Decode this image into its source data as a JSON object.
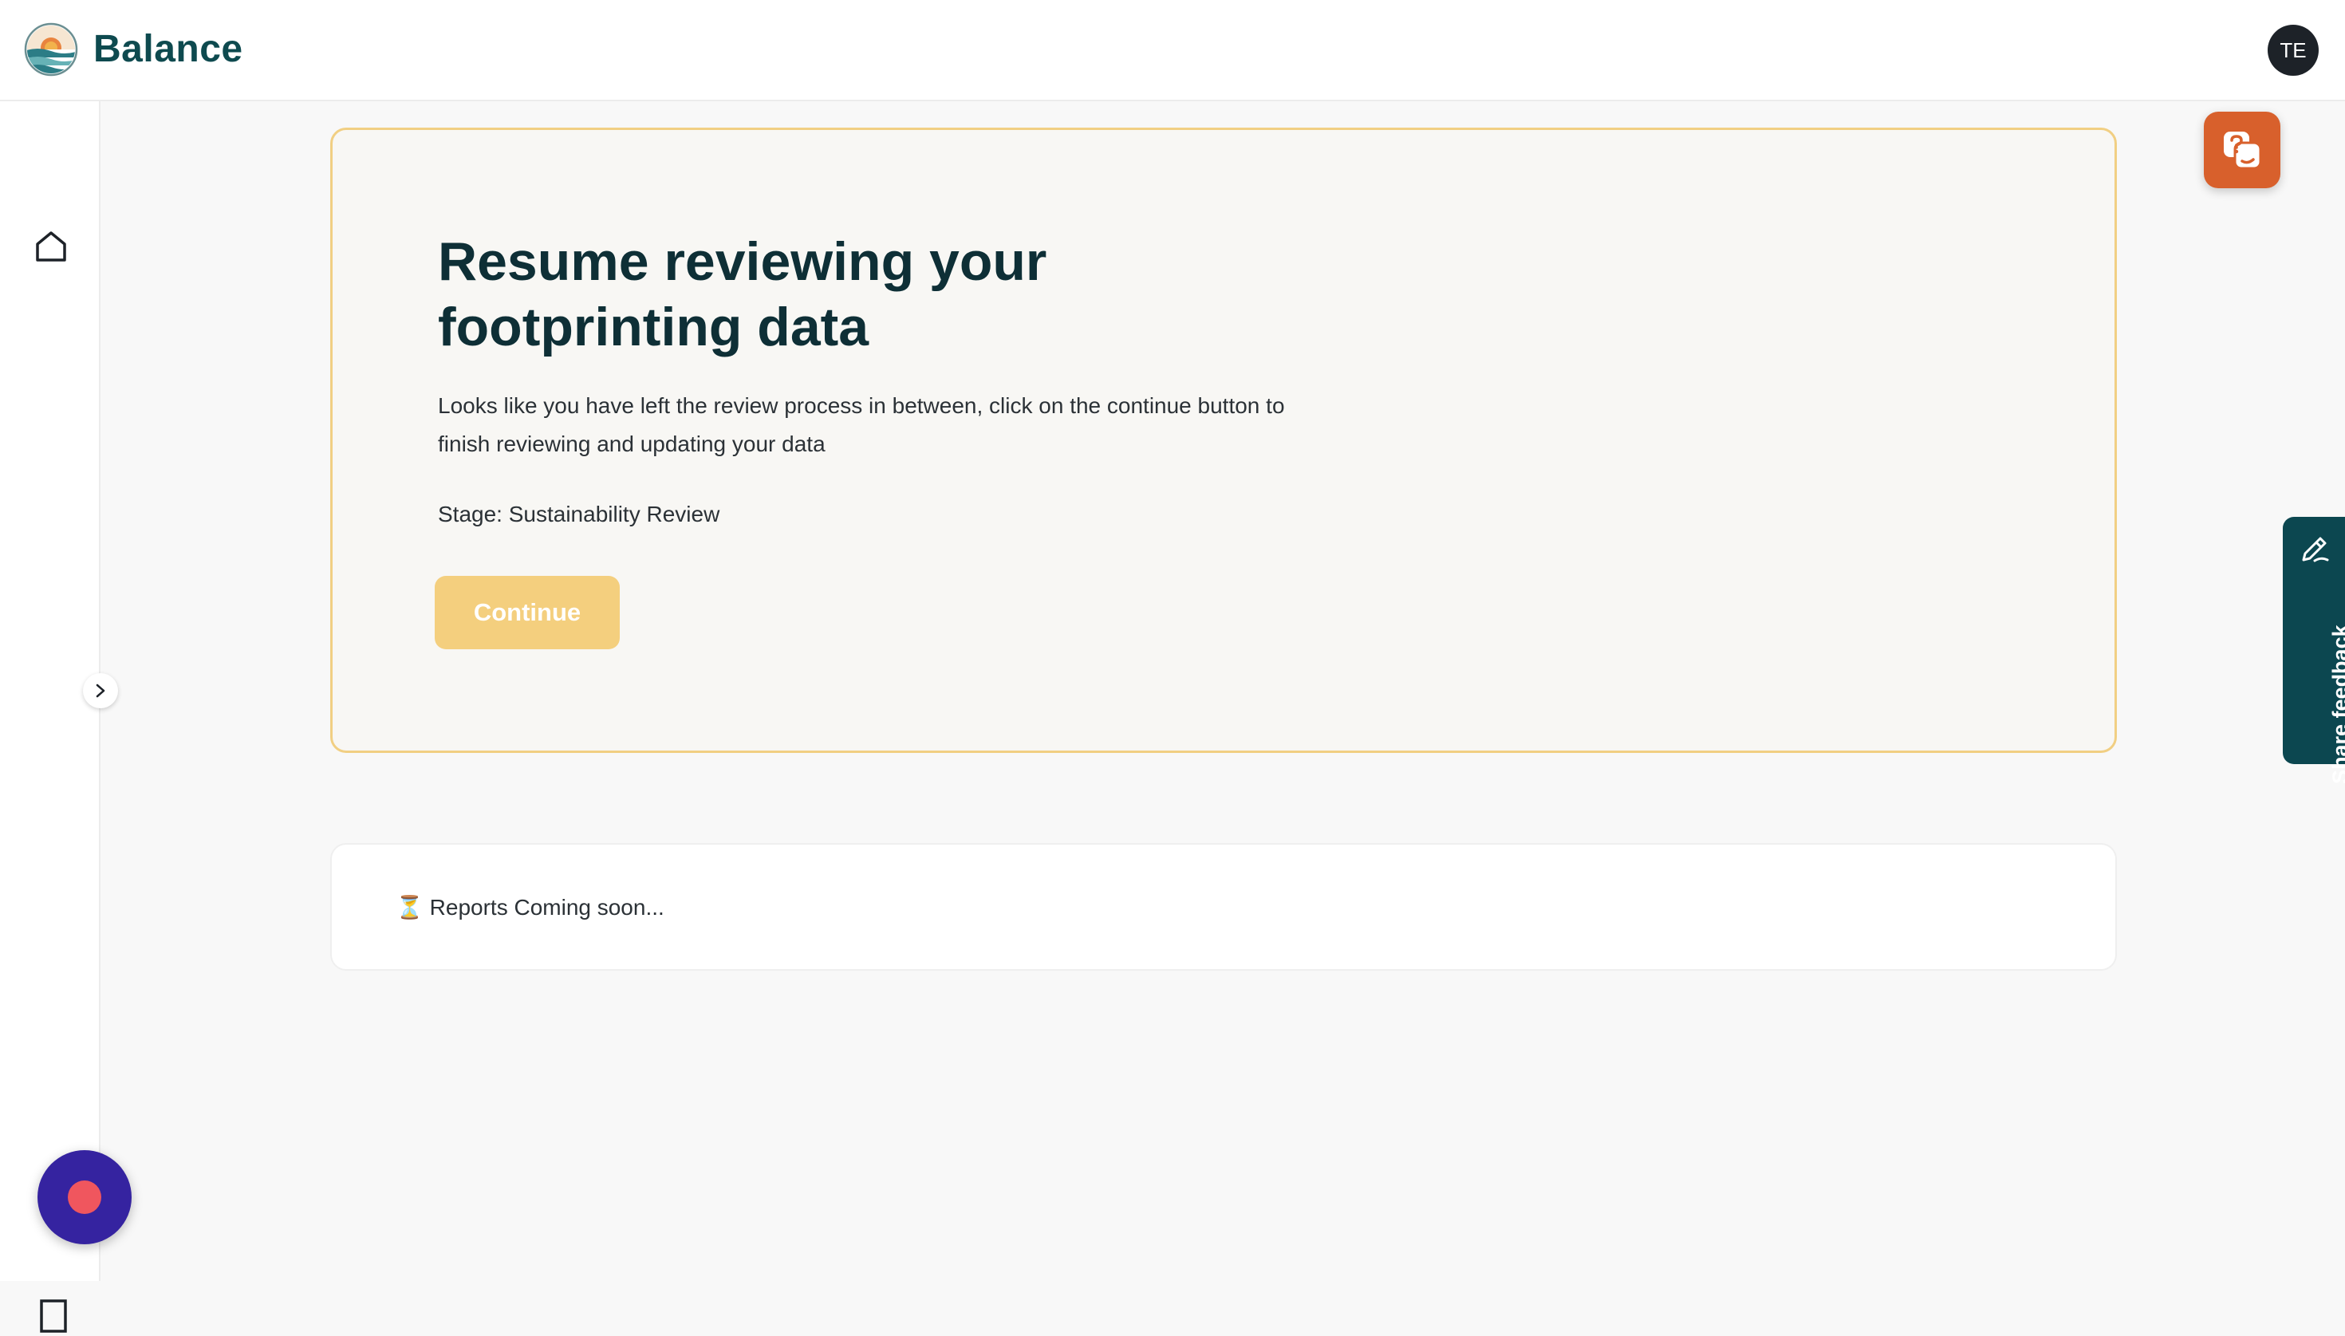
{
  "header": {
    "brand": "Balance",
    "user_initials": "TE"
  },
  "sidebar": {
    "items": [
      {
        "icon": "home-icon"
      }
    ],
    "expand_icon": "chevron-right-icon"
  },
  "resume_card": {
    "title": "Resume reviewing your footprinting data",
    "description": "Looks like you have left the review process in between, click on the continue button to finish reviewing and updating your data",
    "stage": "Stage: Sustainability Review",
    "continue_label": "Continue"
  },
  "reports": {
    "icon": "⏳",
    "text": "Reports Coming soon..."
  },
  "feedback": {
    "label": "Share feedback"
  },
  "colors": {
    "brand": "#0e4a4f",
    "card_border": "#f1cf83",
    "continue_button": "#f4cf7e",
    "help_button": "#d8602c",
    "feedback_tab": "#0c4750",
    "record_button": "#3523a0"
  }
}
